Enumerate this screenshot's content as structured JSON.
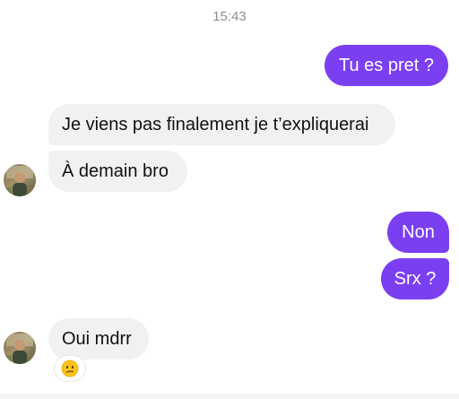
{
  "conversation": {
    "timestamp": "15:43",
    "messages": [
      {
        "id": "b1",
        "direction": "outgoing",
        "text": "Tu es pret ?"
      },
      {
        "id": "b2",
        "direction": "incoming",
        "text": "Je viens pas finalement je t’expliquerai"
      },
      {
        "id": "b3",
        "direction": "incoming",
        "text": "À demain bro"
      },
      {
        "id": "b4",
        "direction": "outgoing",
        "text": "Non"
      },
      {
        "id": "b5",
        "direction": "outgoing",
        "text": "Srx ?"
      },
      {
        "id": "b6",
        "direction": "incoming",
        "text": "Oui mdrr"
      }
    ],
    "reaction": {
      "icon": "confused-face-emoji-icon"
    }
  },
  "colors": {
    "outgoing_bubble": "#7b3ff2",
    "incoming_bubble": "#f0f1f3",
    "timestamp_text": "#8e8e93"
  }
}
